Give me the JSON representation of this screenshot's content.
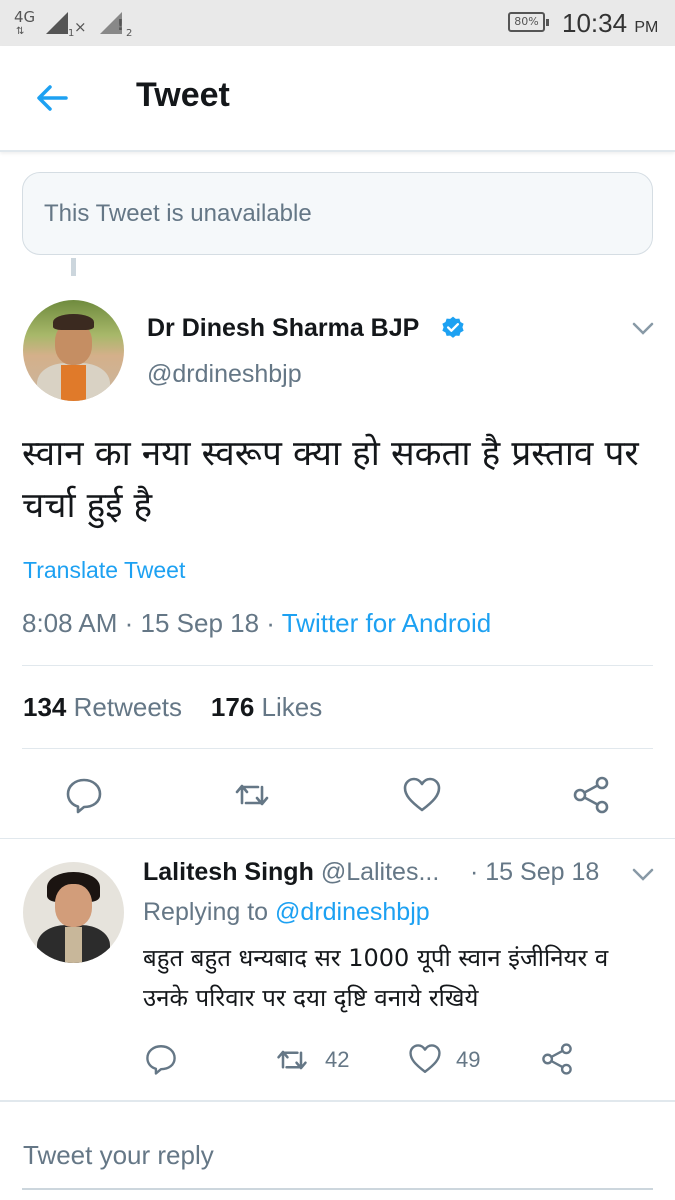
{
  "status_bar": {
    "network": "4G",
    "sim1": "1",
    "sim2": "2",
    "battery": "80%",
    "time": "10:34",
    "ampm": "PM"
  },
  "header": {
    "title": "Tweet"
  },
  "unavailable": {
    "text": "This Tweet is unavailable"
  },
  "tweet": {
    "author_name": "Dr Dinesh Sharma BJP",
    "handle": "@drdineshbjp",
    "text": "स्वान का नया स्वरूप क्या हो सकता है प्रस्ताव पर चर्चा हुई है",
    "translate": "Translate Tweet",
    "time": "8:08 AM",
    "date": "15 Sep 18",
    "source": "Twitter for Android",
    "retweets": "134",
    "retweets_label": "Retweets",
    "likes": "176",
    "likes_label": "Likes"
  },
  "reply": {
    "name": "Lalitesh Singh",
    "handle": "@Lalites...",
    "date": "15 Sep 18",
    "replying_prefix": "Replying to",
    "replying_to": "@drdineshbjp",
    "text": "बहुत बहुत धन्यबाद सर 1000 यूपी स्वान इंजीनियर व उनके परिवार पर दया दृष्टि वनाये रखिये",
    "retweets": "42",
    "likes": "49"
  },
  "composer": {
    "placeholder": "Tweet your reply"
  },
  "colors": {
    "accent": "#1da1f2",
    "secondary_text": "#657786",
    "divider": "#e1e8ed"
  }
}
